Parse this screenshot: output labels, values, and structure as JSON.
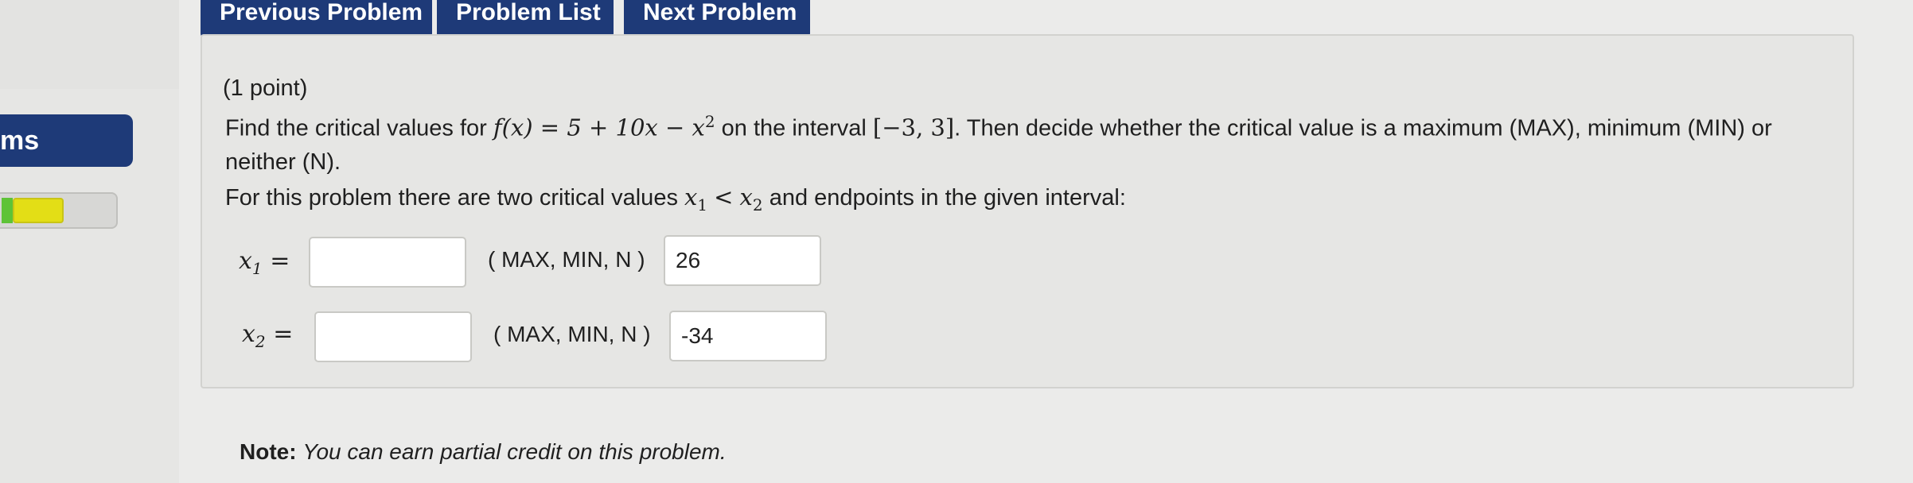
{
  "sidebar": {
    "heading": "ms",
    "progress_value": "partial"
  },
  "nav": {
    "previous_label": "Previous Problem",
    "list_label": "Problem List",
    "next_label": "Next Problem"
  },
  "problem": {
    "points": "(1 point)",
    "instruction_prefix": "Find the critical values for",
    "function_text": "f(x) = 5 + 10x − x",
    "function_power": "2",
    "interval_prefix": "on the interval",
    "interval": "[−3, 3]",
    "instruction_suffix": ". Then decide whether the critical value is a maximum (MAX), minimum (MIN) or",
    "instruction_line2": "neither (N).",
    "critical_prefix": "For this problem there are two critical values",
    "critical_math_x1": "x",
    "critical_sub1": "1",
    "critical_lt": "<",
    "critical_math_x2": "x",
    "critical_sub2": "2",
    "critical_suffix": "and endpoints in the given interval:"
  },
  "answers": [
    {
      "label_var": "x",
      "label_sub": "1",
      "label_eq": "=",
      "input_value": "",
      "choice_label": "( MAX, MIN, N )",
      "choice_value": "26"
    },
    {
      "label_var": "x",
      "label_sub": "2",
      "label_eq": "=",
      "input_value": "",
      "choice_label": "( MAX, MIN, N )",
      "choice_value": "-34"
    }
  ],
  "note": {
    "bold": "Note:",
    "text": "You can earn partial credit on this problem."
  },
  "colors": {
    "nav_button": "#1e3a78",
    "page_background": "#ebebea",
    "panel_background": "#e6e6e4",
    "progress_green": "#5ec337",
    "progress_yellow": "#e3de16"
  }
}
